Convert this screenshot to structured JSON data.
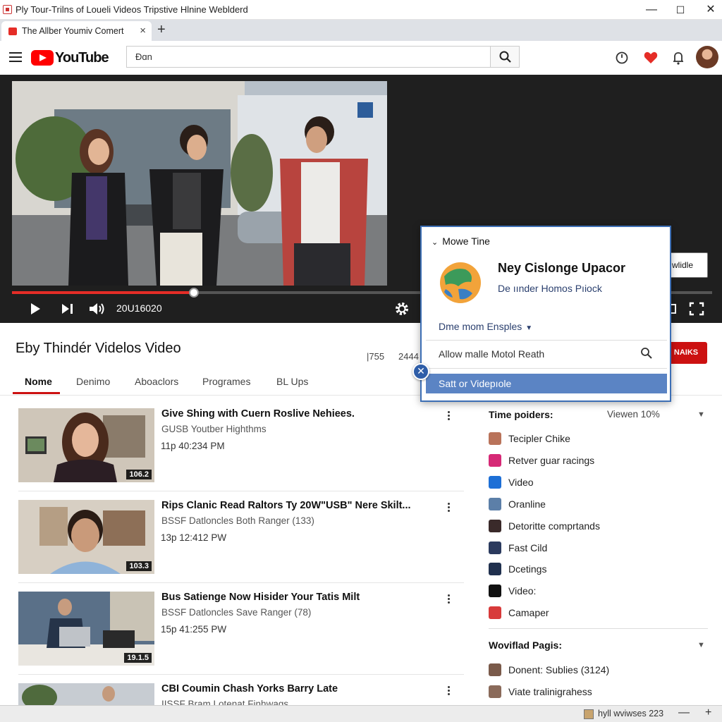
{
  "window": {
    "title": "Ply Tour-Trilns of Loueli Videos Tripstive Hlnine Weblderd",
    "minimize": "—",
    "maximize": "☐",
    "close": "✕"
  },
  "browser": {
    "tab_label": "The Allber Youmiv Comert",
    "tab_close": "×",
    "new_tab": "+"
  },
  "header": {
    "logo_text": "YouTube",
    "search_value": "Ɖɑn"
  },
  "player": {
    "timecode": "20U16020",
    "progress": 0.26,
    "overlay_label": "wlidle"
  },
  "channel": {
    "title": "Eby Thindér Videlos Video",
    "stat_1": "|755",
    "stat_2": "2444",
    "subscribe_label": "NAIKS",
    "tabs": [
      "Nome",
      "Denimo",
      "Aboaclors",
      "Programes",
      "BL Ups"
    ]
  },
  "videos": [
    {
      "title": "Give Shing with Cuern Roslive Nehiees.",
      "channel": "GUSB Youtber Highthms",
      "time": "11p 40:234 PM",
      "duration": "106.2"
    },
    {
      "title": "Rips Clanic Read Raltors Ty 20W\"USB\" Nere Skilt...",
      "channel": "BSSF Datloncles Both Ranger (133)",
      "time": "13p 12:412 PW",
      "duration": "103.3"
    },
    {
      "title": "Bus Satienge Now Hisider Your Tatis Milt",
      "channel": "BSSF Datloncles Save Ranger (78)",
      "time": "15p 41:255 PW",
      "duration": "19.1.5"
    },
    {
      "title": "CBI Coumin Chash Yorks Barry Late",
      "channel": "IISSF Bram Lotenat Finhwags",
      "time": "",
      "duration": ""
    }
  ],
  "sidebar": {
    "heading": "Time poiders:",
    "view_label": "Viewen 10%",
    "items": [
      {
        "label": "Tecipler Chike",
        "color": "#b9735a"
      },
      {
        "label": "Retver guar racings",
        "color": "#d62976"
      },
      {
        "label": "Video",
        "color": "#1d6fd6"
      },
      {
        "label": "Oranline",
        "color": "#5c7fa8"
      },
      {
        "label": "Detoritte comprtands",
        "color": "#3a2a2a"
      },
      {
        "label": "Fast Cild",
        "color": "#2b3a5e"
      },
      {
        "label": "Dcetings",
        "color": "#20304e"
      },
      {
        "label": "Video:",
        "color": "#111111"
      },
      {
        "label": "Camaper",
        "color": "#d83a3a"
      }
    ],
    "heading_2": "Woviflad Pagis:",
    "items_2": [
      {
        "label": "Donent: Sublies (3124)",
        "color": "#7a5a4a"
      },
      {
        "label": "Viate tralinigrahess",
        "color": "#8a6a5a"
      }
    ]
  },
  "popup": {
    "header": "Mowe Tine",
    "title": "Ney Cislonge Upacor",
    "subtitle": "De ıınder Homos Pıiock",
    "dropdown": "Dme mom Ensples",
    "field": "Allow malle Motol Reath",
    "button": "Satt or Videpıole",
    "badge": "✕"
  },
  "statusbar": {
    "zoom_text": "hyll wviwses 223"
  },
  "colors": {
    "accent_red": "#e52d27",
    "popup_border": "#3d6fb5",
    "popup_button": "#5b84c4"
  }
}
